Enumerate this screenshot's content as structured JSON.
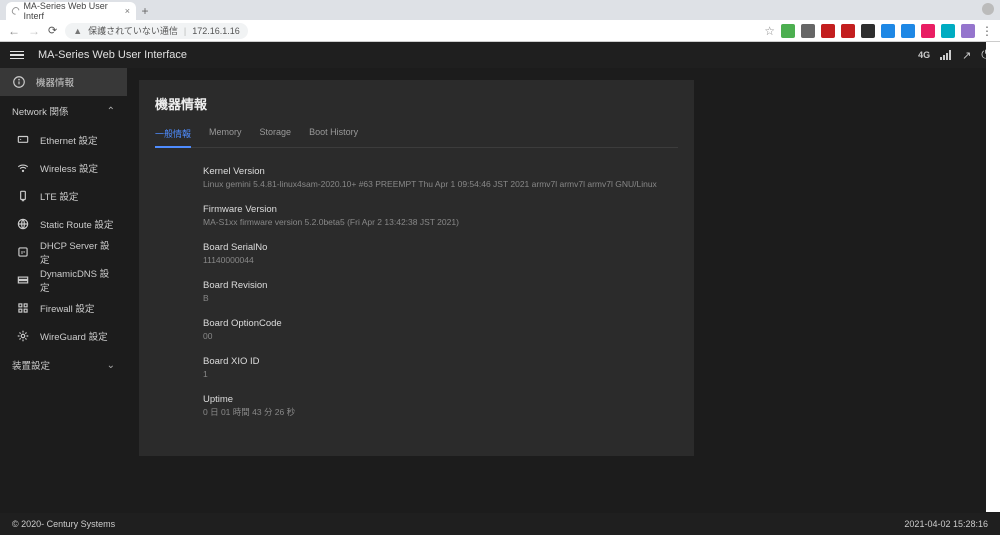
{
  "browser": {
    "tab_title": "MA-Series Web User Interf",
    "url_warning": "保護されていない通信",
    "url": "172.16.1.16"
  },
  "appbar": {
    "title": "MA-Series Web User Interface",
    "signal_label": "4G"
  },
  "sidebar": {
    "active_label": "機器情報",
    "group_network": "Network 関係",
    "items": [
      "Ethernet 設定",
      "Wireless 設定",
      "LTE 設定",
      "Static Route 設定",
      "DHCP Server 設定",
      "DynamicDNS 設定",
      "Firewall 設定",
      "WireGuard 設定"
    ],
    "group_device": "装置設定"
  },
  "page": {
    "title": "機器情報",
    "tabs": [
      "一般情報",
      "Memory",
      "Storage",
      "Boot History"
    ],
    "info": [
      {
        "label": "Kernel Version",
        "value": "Linux gemini 5.4.81-linux4sam-2020.10+ #63 PREEMPT Thu Apr 1 09:54:46 JST 2021 armv7l armv7l armv7l GNU/Linux"
      },
      {
        "label": "Firmware Version",
        "value": "MA-S1xx firmware version 5.2.0beta5 (Fri Apr 2 13:42:38 JST 2021)"
      },
      {
        "label": "Board SerialNo",
        "value": "11140000044"
      },
      {
        "label": "Board Revision",
        "value": "B"
      },
      {
        "label": "Board OptionCode",
        "value": "00"
      },
      {
        "label": "Board XIO ID",
        "value": "1"
      },
      {
        "label": "Uptime",
        "value": "0 日 01 時間 43 分 26 秒"
      }
    ]
  },
  "footer": {
    "copyright": "© 2020- Century Systems",
    "datetime": "2021-04-02 15:28:16"
  },
  "ext_colors": [
    "#4caf50",
    "#666",
    "#c31e1e",
    "#c31e1e",
    "#2e2e2e",
    "#1e88e5",
    "#1e88e5",
    "#e91e63",
    "#00acc1",
    "#9575cd"
  ]
}
